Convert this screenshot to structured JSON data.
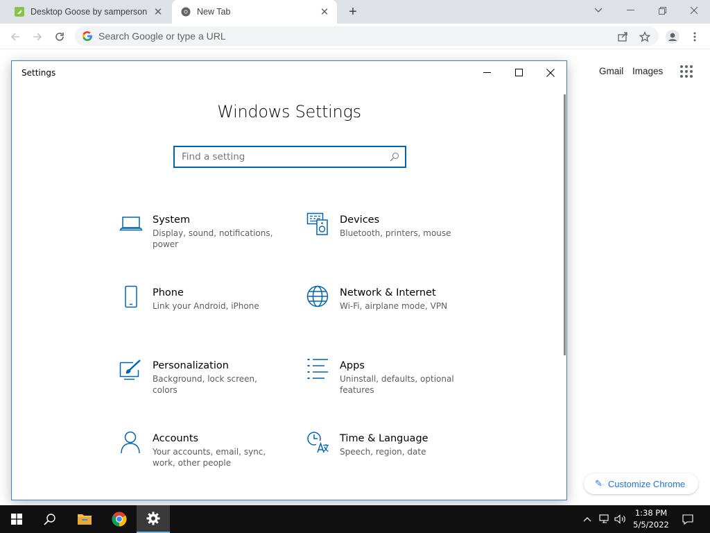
{
  "browser": {
    "tabs": [
      {
        "title": "Desktop Goose by samperson",
        "favicon": "goose-favicon"
      },
      {
        "title": "New Tab",
        "favicon": "chrome-favicon"
      }
    ],
    "omnibox_placeholder": "Search Google or type a URL",
    "ntp": {
      "gmail": "Gmail",
      "images": "Images",
      "customize": "Customize Chrome"
    }
  },
  "settings": {
    "window_title": "Settings",
    "heading": "Windows Settings",
    "search_placeholder": "Find a setting",
    "accent": "#0063b1",
    "categories": [
      {
        "name": "System",
        "desc": "Display, sound, notifications, power",
        "icon": "laptop-icon"
      },
      {
        "name": "Devices",
        "desc": "Bluetooth, printers, mouse",
        "icon": "devices-icon"
      },
      {
        "name": "Phone",
        "desc": "Link your Android, iPhone",
        "icon": "phone-icon"
      },
      {
        "name": "Network & Internet",
        "desc": "Wi-Fi, airplane mode, VPN",
        "icon": "globe-icon"
      },
      {
        "name": "Personalization",
        "desc": "Background, lock screen, colors",
        "icon": "paintbrush-icon"
      },
      {
        "name": "Apps",
        "desc": "Uninstall, defaults, optional features",
        "icon": "apps-list-icon"
      },
      {
        "name": "Accounts",
        "desc": "Your accounts, email, sync, work, other people",
        "icon": "person-icon"
      },
      {
        "name": "Time & Language",
        "desc": "Speech, region, date",
        "icon": "time-language-icon"
      }
    ]
  },
  "taskbar": {
    "time": "1:38 PM",
    "date": "5/5/2022"
  }
}
